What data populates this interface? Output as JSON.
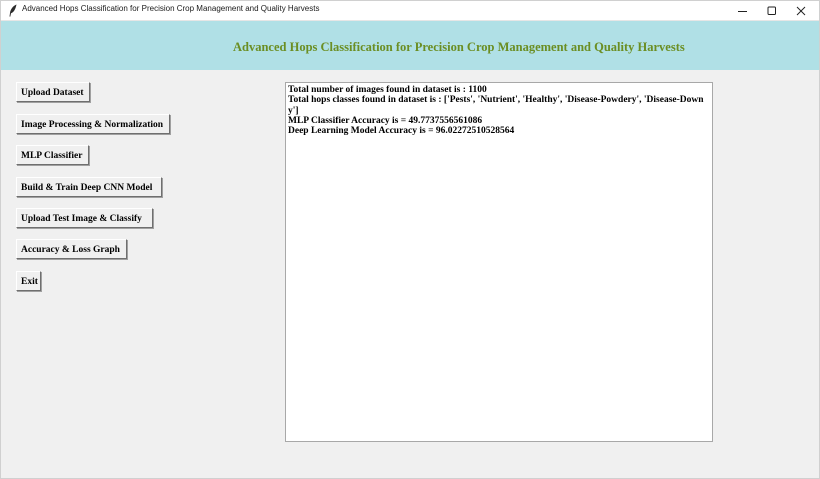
{
  "window": {
    "title": "Advanced Hops Classification for Precision Crop Management and Quality Harvests"
  },
  "header": {
    "title": "Advanced Hops Classification for Precision Crop Management and Quality Harvests",
    "bg_color": "#b0e0e6",
    "title_color": "#6b8e23"
  },
  "buttons": {
    "upload_dataset": "Upload Dataset",
    "image_processing": "Image Processing & Normalization",
    "mlp_classifier": "MLP Classifier",
    "build_train_cnn": "Build & Train Deep CNN Model",
    "upload_test_image": "Upload Test Image & Classify",
    "accuracy_loss_graph": "Accuracy & Loss Graph",
    "exit": "Exit"
  },
  "output": {
    "line1": "Total number of images found in dataset is  : 1100",
    "line2": "Total hops classes found in dataset is : ['Pests', 'Nutrient', 'Healthy', 'Disease-Powdery', 'Disease-Downy']",
    "line3": "MLP Classifier Accuracy is = 49.7737556561086",
    "line4": "Deep Learning Model Accuracy is = 96.02272510528564"
  },
  "icons": {
    "app": "feather-icon",
    "minimize": "minimize-icon",
    "maximize": "maximize-icon",
    "close": "close-icon"
  }
}
